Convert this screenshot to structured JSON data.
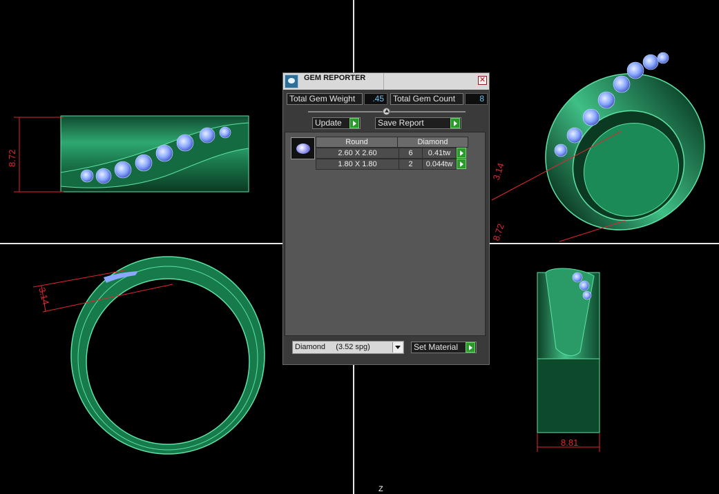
{
  "window": {
    "title": "GEM REPORTER",
    "close_glyph": "✕"
  },
  "totals": {
    "weight_label": "Total Gem Weight",
    "weight_value": ".45",
    "count_label": "Total Gem Count",
    "count_value": "8"
  },
  "toolbar": {
    "update_label": "Update",
    "save_label": "Save Report"
  },
  "report": {
    "shape": "Round",
    "material": "Diamond",
    "rows": [
      {
        "size": "2.60 X 2.60",
        "count": "6",
        "weight": "0.41tw"
      },
      {
        "size": "1.80 X 1.80",
        "count": "2",
        "weight": "0.044tw"
      }
    ]
  },
  "material_select": {
    "value": "Diamond     (3.52 spg)"
  },
  "set_material_label": "Set Material",
  "dimensions": {
    "top_left": "8.72",
    "top_right_a": "3.14",
    "top_right_b": "8.72",
    "bottom_left": "3.14",
    "bottom_right": "8.81"
  },
  "axis_label": "Z",
  "colors": {
    "ring": "#1f8a5a",
    "ring_light": "#4fe0a0",
    "gem": "#8aa8ff",
    "dimension": "#e3262f",
    "accent": "#6ec3f0"
  },
  "icons": [
    "gem-reporter-icon",
    "close-icon",
    "slider-knob-icon",
    "play-arrow-icon",
    "gem-thumbnail-icon",
    "dropdown-arrow-icon"
  ]
}
